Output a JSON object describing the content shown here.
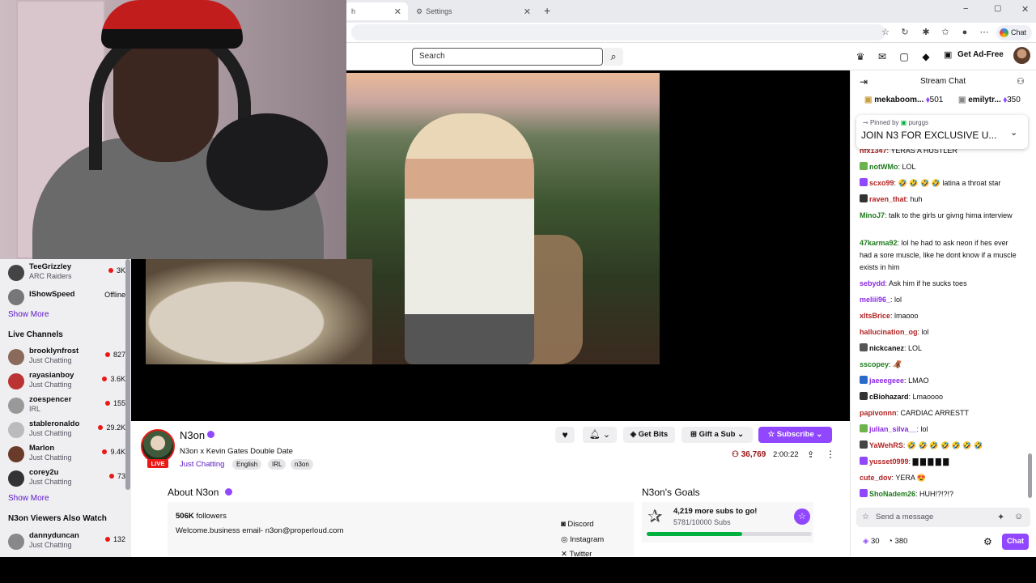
{
  "browser": {
    "tabs": [
      {
        "label": "h",
        "active": true
      },
      {
        "label": "Settings",
        "active": false
      }
    ],
    "chat_button": "Chat"
  },
  "nav": {
    "search_placeholder": "Search",
    "ad_free": "Get Ad-Free"
  },
  "sidebar": {
    "followed": [
      {
        "name": "TeeGrizzley",
        "game": "ARC Raiders",
        "viewers": "3K",
        "live": true,
        "color": "#444"
      },
      {
        "name": "IShowSpeed",
        "game": "",
        "viewers": "Offline",
        "live": false,
        "color": "#777"
      }
    ],
    "show_more_1": "Show More",
    "live_heading": "Live Channels",
    "live": [
      {
        "name": "brooklynfrost",
        "game": "Just Chatting",
        "viewers": "827",
        "color": "#8a6a5a"
      },
      {
        "name": "rayasianboy",
        "game": "Just Chatting",
        "viewers": "3.6K",
        "color": "#b33"
      },
      {
        "name": "zoespencer",
        "game": "IRL",
        "viewers": "155",
        "color": "#999"
      },
      {
        "name": "stableronaldo",
        "game": "Just Chatting",
        "viewers": "29.2K",
        "color": "#bbb"
      },
      {
        "name": "Marlon",
        "game": "Just Chatting",
        "viewers": "9.4K",
        "color": "#6a3a2a"
      },
      {
        "name": "corey2u",
        "game": "Just Chatting",
        "viewers": "73",
        "color": "#333"
      }
    ],
    "show_more_2": "Show More",
    "also_watch_heading": "N3on Viewers Also Watch",
    "also_watch": [
      {
        "name": "dannyduncan",
        "game": "Just Chatting",
        "viewers": "132",
        "color": "#888"
      }
    ]
  },
  "stream": {
    "streamer": "N3on",
    "live_label": "LIVE",
    "title": "N3on x Kevin Gates Double Date",
    "category": "Just Chatting",
    "tags": [
      "English",
      "IRL",
      "n3on"
    ],
    "get_bits": "Get Bits",
    "gift_sub": "Gift a Sub",
    "subscribe": "Subscribe",
    "viewers": "36,769",
    "uptime": "2:00:22"
  },
  "about": {
    "title": "About N3on",
    "followers_count": "506K",
    "followers_label": "followers",
    "bio": "Welcome.business email- n3on@properloud.com",
    "socials": [
      "Discord",
      "Instagram",
      "Twitter"
    ]
  },
  "goals": {
    "title": "N3on's Goals",
    "main": "4,219 more subs to go!",
    "sub": "5781/10000 Subs",
    "progress": 0.5781
  },
  "chat": {
    "header": "Stream Chat",
    "gifters": [
      {
        "name": "mekaboom...",
        "count": "501"
      },
      {
        "name": "emilytr...",
        "count": "350"
      }
    ],
    "pinned_by_label": "Pinned by",
    "pinned_by": "purggs",
    "pinned_msg": "JOIN N3 FOR EXCLUSIVE U...",
    "messages": [
      {
        "user": "nfx1347",
        "color": "#b22222",
        "text": "YERAS A HUSTLER",
        "badge": ""
      },
      {
        "user": "notWMo",
        "color": "#1e7b1e",
        "text": "LOL",
        "badge": "#6bb34b"
      },
      {
        "user": "scxo99",
        "color": "#b22222",
        "text": "🤣 🤣 🤣 🤣 latina a throat star",
        "badge": "#9147ff"
      },
      {
        "user": "raven_that",
        "color": "#b22222",
        "text": "huh",
        "badge": "#333"
      },
      {
        "user": "MinoJ7",
        "color": "#1e7b1e",
        "text": "talk to the girls ur givng hima interview",
        "badge": ""
      },
      {
        "user": "47karma92",
        "color": "#1e7b1e",
        "text": "lol he had to ask neon if hes ever had a sore muscle, like he dont know if a muscle exists in him",
        "badge": ""
      },
      {
        "user": "sebydd",
        "color": "#8a2be2",
        "text": "Ask him if he sucks toes",
        "badge": ""
      },
      {
        "user": "meliii96_",
        "color": "#8a2be2",
        "text": "lol",
        "badge": ""
      },
      {
        "user": "xltsBrice",
        "color": "#b22222",
        "text": "lmaooo",
        "badge": ""
      },
      {
        "user": "hallucination_og",
        "color": "#b22222",
        "text": "lol",
        "badge": ""
      },
      {
        "user": "nickcanez",
        "color": "#0e0e10",
        "text": "LOL",
        "badge": "#555"
      },
      {
        "user": "sscopey",
        "color": "#1e7b1e",
        "text": "🦧",
        "badge": ""
      },
      {
        "user": "jaeeegeee",
        "color": "#8a2be2",
        "text": "LMAO",
        "badge": "#2a6ac8"
      },
      {
        "user": "cBiohazard",
        "color": "#0e0e10",
        "text": "Lmaoooo",
        "badge": "#333"
      },
      {
        "user": "papivonnn",
        "color": "#b22222",
        "text": "CARDIAC ARRESTT",
        "badge": ""
      },
      {
        "user": "julian_silva__",
        "color": "#8a2be2",
        "text": "lol",
        "badge": "#6bb34b"
      },
      {
        "user": "YaWehRS",
        "color": "#b22222",
        "text": "🤣 🤣 🤣 🤣 🤣 🤣 🤣",
        "badge": "#444"
      },
      {
        "user": "yusset0999",
        "color": "#b22222",
        "text": "▇ ▇ ▇ ▇ ▇",
        "badge": "#9147ff"
      },
      {
        "user": "cute_dov",
        "color": "#b22222",
        "text": "YERA 😍",
        "badge": ""
      },
      {
        "user": "ShoNadem26",
        "color": "#1e7b1e",
        "text": "HUH!?!?!?",
        "badge": "#9147ff"
      }
    ],
    "input_placeholder": "Send a message",
    "bits": "30",
    "points": "380",
    "chat_btn": "Chat"
  }
}
